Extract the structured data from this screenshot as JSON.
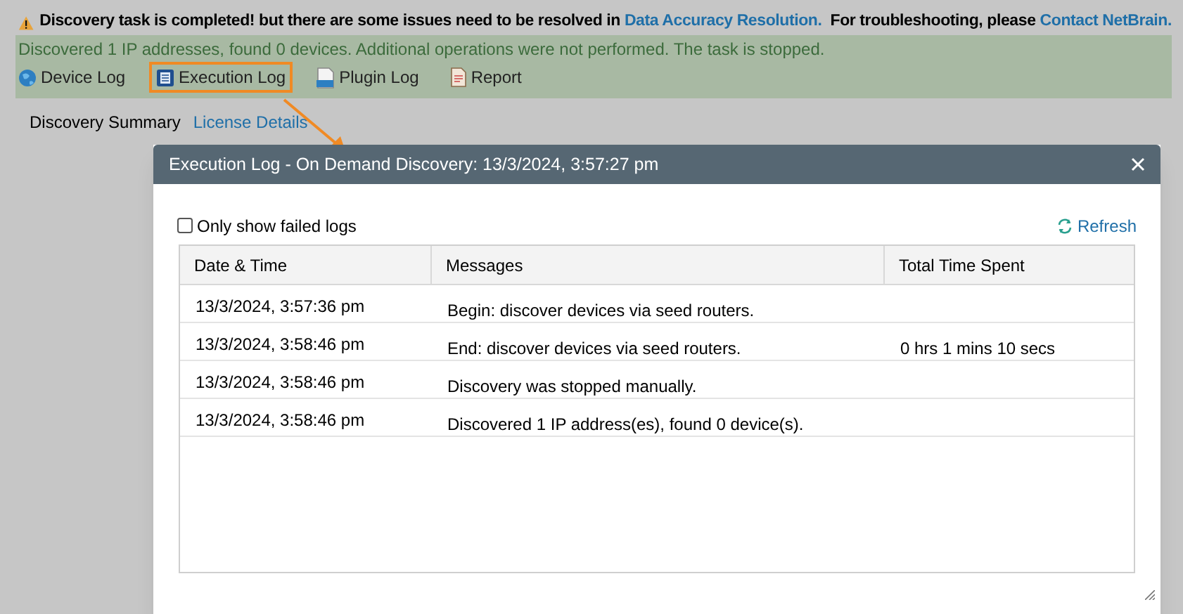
{
  "alert": {
    "text": "Discovery task is completed! but there are some issues need to be resolved in",
    "link": "Data Accuracy Resolution.",
    "text_2": "For troubleshooting, please",
    "link_2": "Contact NetBrain."
  },
  "status": "Discovered 1 IP addresses, found 0 devices.  Additional operations were not performed. The task is stopped.",
  "log_links": [
    {
      "label": "Device Log",
      "kind": "globe",
      "highlighted": false
    },
    {
      "label": "Execution Log",
      "kind": "book",
      "highlighted": true
    },
    {
      "label": "Plugin Log",
      "kind": "logfile",
      "highlighted": false
    },
    {
      "label": "Report",
      "kind": "report",
      "highlighted": false
    }
  ],
  "tabs": [
    {
      "label": "Discovery Summary",
      "selected": true
    },
    {
      "label": "License Details",
      "selected": false
    }
  ],
  "dialog": {
    "title": "Execution Log - On Demand Discovery: 13/3/2024, 3:57:27 pm",
    "filter": {
      "label": "Only show failed logs",
      "checked": false
    },
    "refresh": "Refresh",
    "table": {
      "columns": [
        "Date & Time",
        "Messages",
        "Total Time Spent"
      ],
      "rows": [
        [
          "13/3/2024, 3:57:36 pm",
          "Begin: discover devices via seed routers.",
          ""
        ],
        [
          "13/3/2024, 3:58:46 pm",
          "End: discover devices via seed routers.",
          "0 hrs 1 mins 10 secs"
        ],
        [
          "13/3/2024, 3:58:46 pm",
          "Discovery was stopped manually.",
          ""
        ],
        [
          "13/3/2024, 3:58:46 pm",
          "Discovered 1 IP address(es), found 0 device(s).",
          ""
        ]
      ]
    }
  }
}
